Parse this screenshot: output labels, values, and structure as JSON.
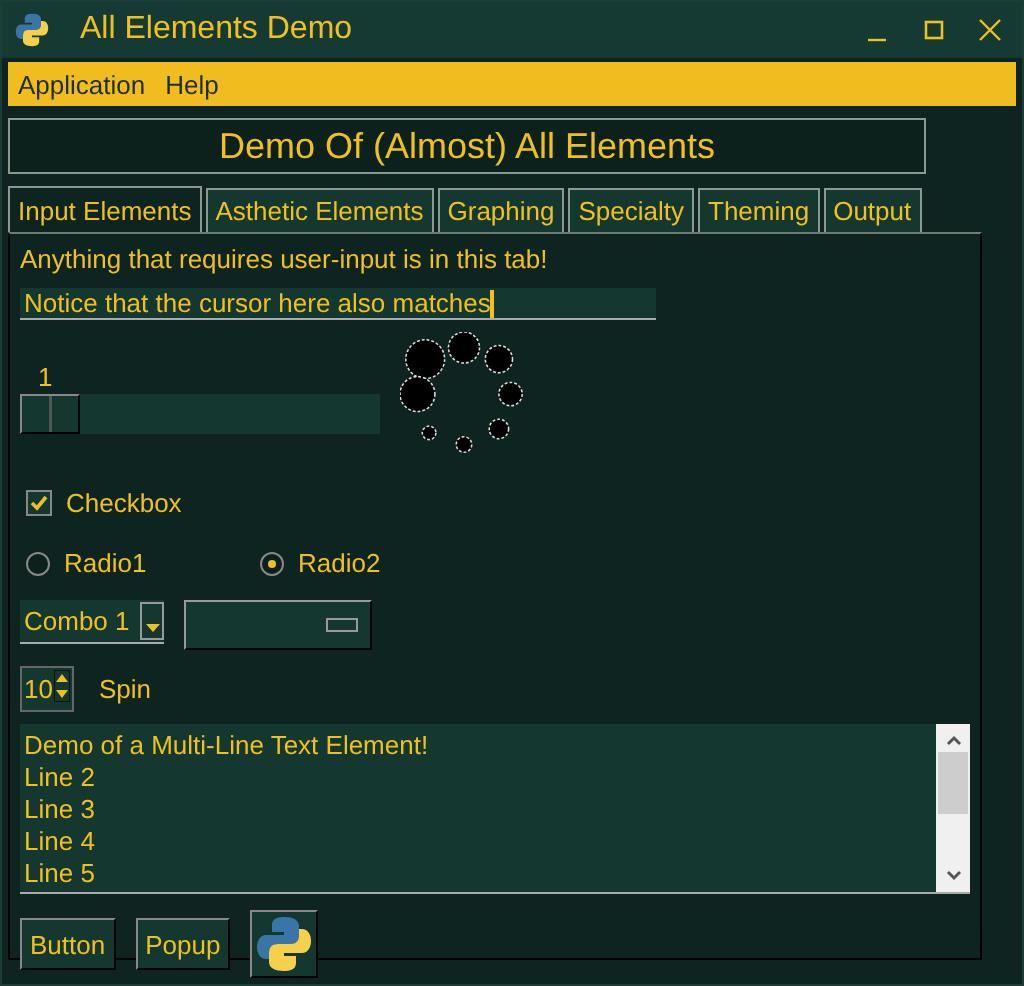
{
  "window": {
    "title": "All Elements Demo"
  },
  "menu": [
    "Application",
    "Help"
  ],
  "heading": "Demo Of (Almost) All Elements",
  "tabs": [
    {
      "label": "Input Elements",
      "selected": true
    },
    {
      "label": "Asthetic Elements",
      "selected": false
    },
    {
      "label": "Graphing",
      "selected": false
    },
    {
      "label": "Specialty",
      "selected": false
    },
    {
      "label": "Theming",
      "selected": false
    },
    {
      "label": "Output",
      "selected": false
    }
  ],
  "intro": "Anything that requires user-input is in this tab!",
  "input": {
    "value": "Notice that the cursor here also matches"
  },
  "slider": {
    "reading": "1",
    "level": 0
  },
  "checkbox": {
    "label": "Checkbox",
    "checked": true
  },
  "radios": [
    {
      "label": "Radio1",
      "selected": false
    },
    {
      "label": "Radio2",
      "selected": true
    }
  ],
  "combo": {
    "value": "Combo 1"
  },
  "spin": {
    "value": "10",
    "label": "Spin"
  },
  "multiline": [
    "Demo of a Multi-Line Text Element!",
    "Line 2",
    "Line 3",
    "Line 4",
    "Line 5"
  ],
  "buttons": [
    "Button",
    "Popup"
  ]
}
